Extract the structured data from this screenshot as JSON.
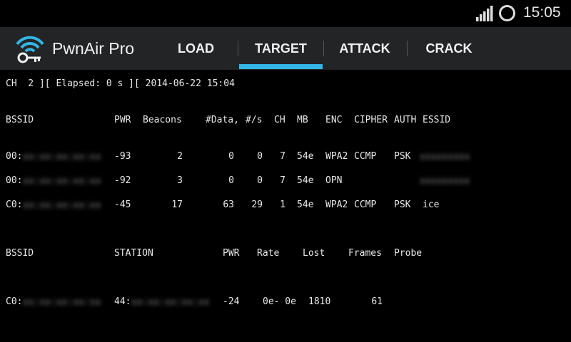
{
  "status_bar": {
    "time": "15:05",
    "icons": [
      "signal-icon",
      "circle-icon"
    ]
  },
  "action_bar": {
    "app_title": "PwnAir Pro",
    "app_icon": "wifi-key-icon",
    "tabs": [
      {
        "label": "LOAD",
        "selected": false
      },
      {
        "label": "TARGET",
        "selected": true
      },
      {
        "label": "ATTACK",
        "selected": false
      },
      {
        "label": "CRACK",
        "selected": false
      }
    ],
    "accent_color": "#33b5e5"
  },
  "terminal": {
    "header_line": "CH  2 ][ Elapsed: 0 s ][ 2014-06-22 15:04",
    "ap_table": {
      "headers": [
        "BSSID",
        "PWR",
        "Beacons",
        "#Data,",
        "#/s",
        "CH",
        "MB",
        "ENC",
        "CIPHER",
        "AUTH",
        "ESSID"
      ],
      "rows": [
        {
          "bssid_prefix": "00:",
          "bssid_hidden": "xx:xx:xx:xx:xx",
          "pwr": "-93",
          "beacons": "2",
          "data": "0",
          "per_s": "0",
          "ch": "7",
          "mb": "54e",
          "enc": "WPA2",
          "cipher": "CCMP",
          "auth": "PSK",
          "essid": "",
          "essid_hidden": "xxxxxxxxx"
        },
        {
          "bssid_prefix": "00:",
          "bssid_hidden": "xx:xx:xx:xx:xx",
          "pwr": "-92",
          "beacons": "3",
          "data": "0",
          "per_s": "0",
          "ch": "7",
          "mb": "54e",
          "enc": "OPN",
          "cipher": "",
          "auth": "",
          "essid": "",
          "essid_hidden": "xxxxxxxxx"
        },
        {
          "bssid_prefix": "C0:",
          "bssid_hidden": "xx:xx:xx:xx:xx",
          "pwr": "-45",
          "beacons": "17",
          "data": "63",
          "per_s": "29",
          "ch": "1",
          "mb": "54e",
          "enc": "WPA2",
          "cipher": "CCMP",
          "auth": "PSK",
          "essid": "ice",
          "essid_hidden": ""
        }
      ]
    },
    "station_table": {
      "headers": [
        "BSSID",
        "STATION",
        "PWR",
        "Rate",
        "Lost",
        "Frames",
        "Probe"
      ],
      "rows": [
        {
          "bssid_prefix": "C0:",
          "bssid_hidden": "xx:xx:xx:xx:xx",
          "station_prefix": "44:",
          "station_hidden": "xx:xx:xx:xx:xx",
          "pwr": "-24",
          "rate": "0e- 0e",
          "lost": "1810",
          "frames": "61",
          "probe": ""
        }
      ]
    }
  }
}
